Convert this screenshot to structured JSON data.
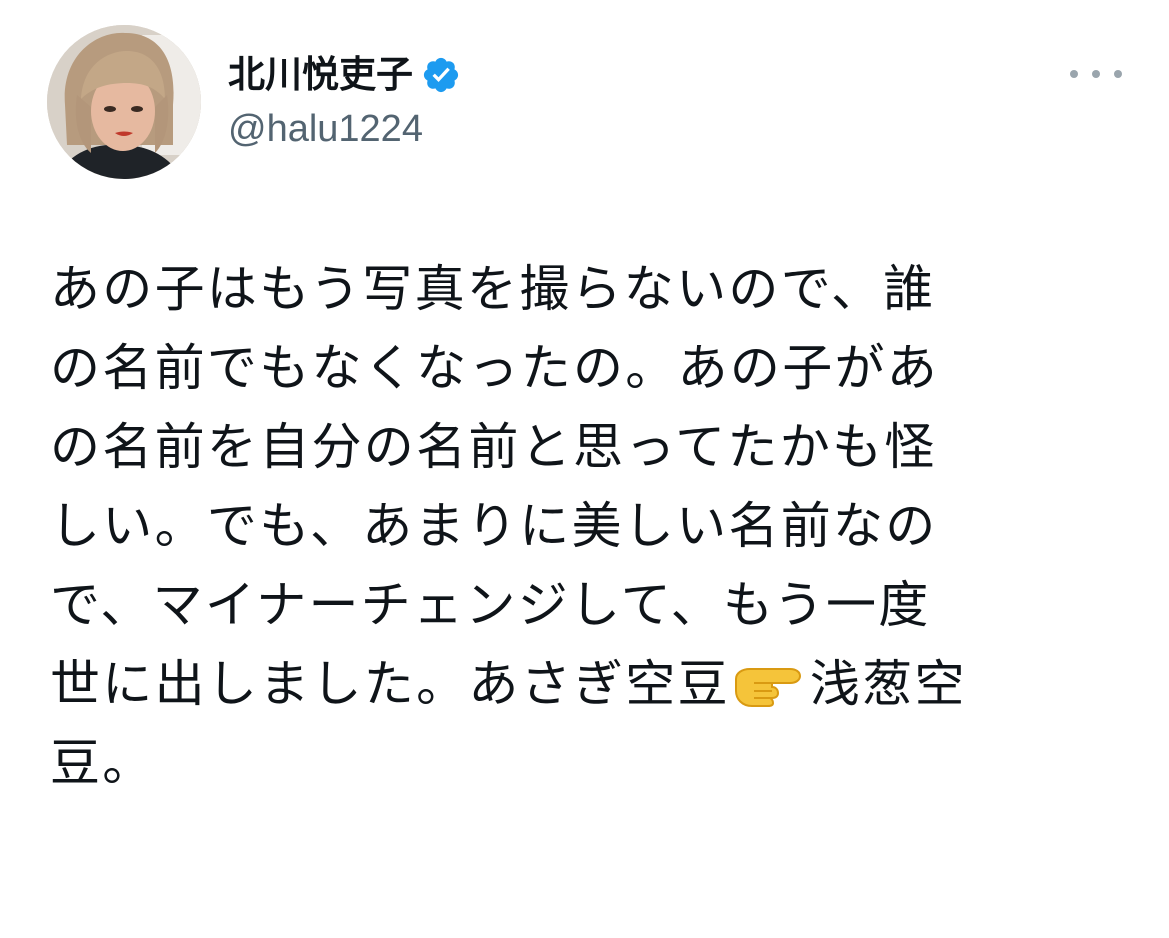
{
  "author": {
    "display_name": "北川悦吏子",
    "handle": "@halu1224",
    "verified": true,
    "verified_badge_color": "#1d9bf0"
  },
  "menu": {
    "icon": "more-horizontal-icon"
  },
  "tweet": {
    "lines": [
      "あの子はもう写真を撮らないので、誰",
      "の名前でもなくなったの。あの子があ",
      "の名前を自分の名前と思ってたかも怪",
      "しい。でも、あまりに美しい名前なの",
      "で、マイナーチェンジして、もう一度"
    ],
    "last_line_before_emoji": "世に出しました。あさぎ空豆",
    "emoji": "backhand-index-pointing-right",
    "last_line_after_emoji": "浅葱空",
    "final_line": "豆。"
  },
  "colors": {
    "text": "#0f1419",
    "secondary_text": "#536471",
    "background": "#ffffff"
  }
}
